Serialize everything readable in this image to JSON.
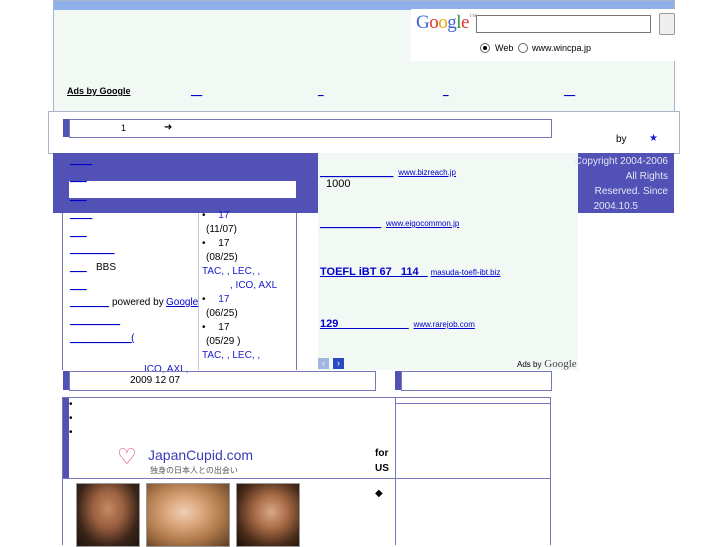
{
  "google": {
    "logo": "Google",
    "search_value": "",
    "radio_web": "Web",
    "radio_site": "www.wincpa.jp"
  },
  "ads_top": {
    "label": "Ads by Google",
    "links": [
      "__",
      "_",
      "_",
      "__"
    ]
  },
  "header_bar": {
    "page_num": "1",
    "arrow": "➜",
    "by": "by",
    "star": "★"
  },
  "copyright": {
    "lines": [
      "Copyright 2004-2006",
      "All Rights",
      "Reserved. Since",
      "2004.10.5"
    ]
  },
  "left_nav": {
    "items": [
      "____",
      "___",
      "___",
      "____",
      "___",
      "________",
      "___",
      "___",
      "_______",
      "_________",
      "___________("
    ],
    "bbs": "BBS",
    "powered_by": "powered by",
    "google": "Google"
  },
  "news": [
    {
      "bullet": "•",
      "num": "17",
      "date": "(11/07)",
      "extra": ""
    },
    {
      "bullet": "•",
      "num": "17",
      "date": "(08/25)",
      "extra": "TAC,    , LEC,       ,"
    },
    {
      "bullet": "•",
      "num": "17",
      "date": "(06/25)",
      "extra": ", ICO, AXL"
    },
    {
      "bullet": "•",
      "num": "17",
      "date": "(05/29 )",
      "extra": "TAC,    , LEC,       ,"
    }
  ],
  "news_tail": "ICO, AXL,",
  "ads_right": [
    {
      "title": "____________",
      "url": "www.bizreach.jp",
      "desc": "1000"
    },
    {
      "title": "__________",
      "url": "www.eigocommon.jp",
      "desc": ""
    },
    {
      "title": "TOEFL iBT 67   114   ",
      "url": "masuda-toefl-ibt.biz",
      "desc": ""
    },
    {
      "title": "129  ___________",
      "url": "www.rarejob.com",
      "desc": ""
    }
  ],
  "ads_right_footer": {
    "label": "Ads by",
    "google": "Google"
  },
  "date_bar": {
    "date": "2009 12 07"
  },
  "japancupid": {
    "logo": "JapanCupid.com",
    "tagline": "独身の日本人との出会い",
    "for": "for",
    "us": "US",
    "diamond": "◆"
  },
  "colors": {
    "purple": "#5151b6",
    "panel_bg": "#f2f8f4",
    "link": "#0000cc"
  }
}
